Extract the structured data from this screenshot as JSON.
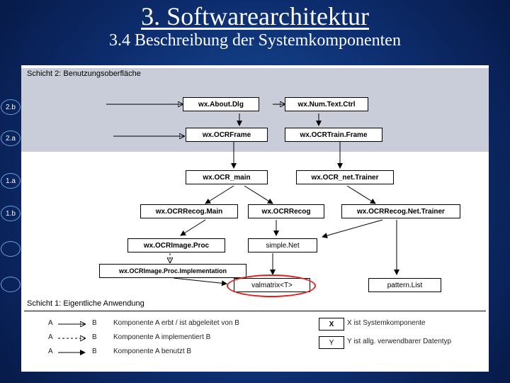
{
  "title": "3. Softwarearchitektur",
  "subtitle": "3.4 Beschreibung der Systemkomponenten",
  "layers": {
    "layer2": "Schicht 2: Benutzungsoberfläche",
    "layer1": "Schicht 1: Eigentliche Anwendung"
  },
  "circles": {
    "c2b": "2.b",
    "c2a": "2.a",
    "c1a": "1.a",
    "c1b": "1.b"
  },
  "boxes": {
    "aboutDlg": "wx.About.Dlg",
    "numText": "wx.Num.Text.Ctrl",
    "ocrFrame": "wx.OCRFrame",
    "ocrTrainFrame": "wx.OCRTrain.Frame",
    "ocrMain": "wx.OCR_main",
    "netTrainer": "wx.OCR_net.Trainer",
    "recogMain": "wx.OCRRecog.Main",
    "recog": "wx.OCRRecog",
    "recogNetTrainer": "wx.OCRRecog.Net.Trainer",
    "imageProc": "wx.OCRImage.Proc",
    "simpleNet": "simple.Net",
    "imageProcImpl": "wx.OCRImage.Proc.Implementation",
    "valmatrix": "valmatrix<T>",
    "patternList": "pattern.List"
  },
  "legend": {
    "line_a": "Komponente A erbt / ist abgeleitet von B",
    "line_b": "Komponente A implementiert B",
    "line_c": "Komponente A benutzt B",
    "right_x": "X ist Systemkomponente",
    "right_y": "Y ist allg. verwendbarer Datentyp",
    "A": "A",
    "B": "B",
    "X": "X",
    "Y": "Y"
  }
}
